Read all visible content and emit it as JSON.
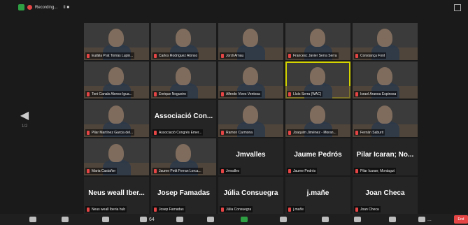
{
  "topbar": {
    "recording_label": "Recording...",
    "controls": "II ■"
  },
  "nav": {
    "left_arrow": "◀",
    "page": "1/2"
  },
  "tiles": [
    {
      "kind": "video",
      "name": "Eulàlia Prat Tomàs Lupin..."
    },
    {
      "kind": "video",
      "name": "Carlos Rodríguez Alonso"
    },
    {
      "kind": "video",
      "name": "Jordi Arnau"
    },
    {
      "kind": "video",
      "name": "Francesc Javier Serra Serra"
    },
    {
      "kind": "video",
      "name": "Constança Font"
    },
    {
      "kind": "video",
      "name": "Toni Canals Alonso Igua..."
    },
    {
      "kind": "video",
      "name": "Enrique Nogueiro"
    },
    {
      "kind": "video",
      "name": "Alfredo Vives Ventosa"
    },
    {
      "kind": "video",
      "name": "Lluís Serra (WAC)",
      "active": true
    },
    {
      "kind": "video",
      "name": "Israel Aranoa Espinosa"
    },
    {
      "kind": "video",
      "name": "Pilar Martínez Garcia del..."
    },
    {
      "kind": "name",
      "big": "Associació Con...",
      "name": "Associació Congrés Emer..."
    },
    {
      "kind": "video",
      "name": "Ramon Carmona"
    },
    {
      "kind": "video",
      "name": "Joaquim Jiménez - Moran..."
    },
    {
      "kind": "video",
      "name": "Fernán Saburit"
    },
    {
      "kind": "video",
      "name": "Maria Castañer"
    },
    {
      "kind": "video",
      "name": "Jaume Petit Ferran Lorca..."
    },
    {
      "kind": "name",
      "big": "Jmvalles",
      "name": "Jmvalles"
    },
    {
      "kind": "name",
      "big": "Jaume Pedrós",
      "name": "Jaume Pedrós"
    },
    {
      "kind": "name",
      "big": "Pilar Icaran; No...",
      "name": "Pilar Icaran; Montagut"
    },
    {
      "kind": "name",
      "big": "Neus weall Iber...",
      "name": "Neus weall Iberia hub"
    },
    {
      "kind": "name",
      "big": "Josep Famadas",
      "name": "Josep Famadas"
    },
    {
      "kind": "name",
      "big": "Júlia Consuegra",
      "name": "Júlia Consuegra"
    },
    {
      "kind": "name",
      "big": "j.mañe",
      "name": "j.mañe"
    },
    {
      "kind": "name",
      "big": "Joan Checa",
      "name": "Joan Checa"
    }
  ],
  "toolbar": {
    "items": [
      {
        "name": "mute",
        "label": ""
      },
      {
        "name": "video",
        "label": ""
      },
      {
        "name": "security",
        "label": ""
      },
      {
        "name": "participants",
        "label": "64"
      },
      {
        "name": "polls",
        "label": ""
      },
      {
        "name": "chat",
        "label": ""
      },
      {
        "name": "share",
        "label": ""
      },
      {
        "name": "record",
        "label": ""
      },
      {
        "name": "reactions",
        "label": ""
      },
      {
        "name": "apps",
        "label": ""
      },
      {
        "name": "whiteboard",
        "label": ""
      },
      {
        "name": "more",
        "label": "..."
      }
    ],
    "end_label": "End"
  }
}
